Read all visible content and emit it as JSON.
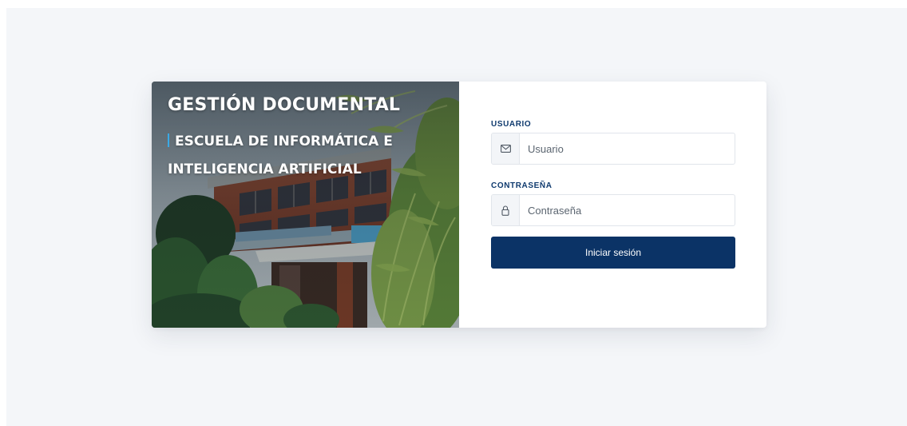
{
  "hero": {
    "title": "GESTIÓN DOCUMENTAL",
    "subtitle": "ESCUELA DE INFORMÁTICA E INTELIGENCIA ARTIFICIAL"
  },
  "login": {
    "username": {
      "label": "USUARIO",
      "placeholder": "Usuario",
      "icon": "envelope-icon"
    },
    "password": {
      "label": "CONTRASEÑA",
      "placeholder": "Contraseña",
      "icon": "lock-icon"
    },
    "submit_label": "Iniciar sesión"
  },
  "colors": {
    "primary": "#0b3366",
    "label": "#0f3a6e",
    "accent_bar": "#39a9e6",
    "page_background": "#f4f6f9"
  }
}
